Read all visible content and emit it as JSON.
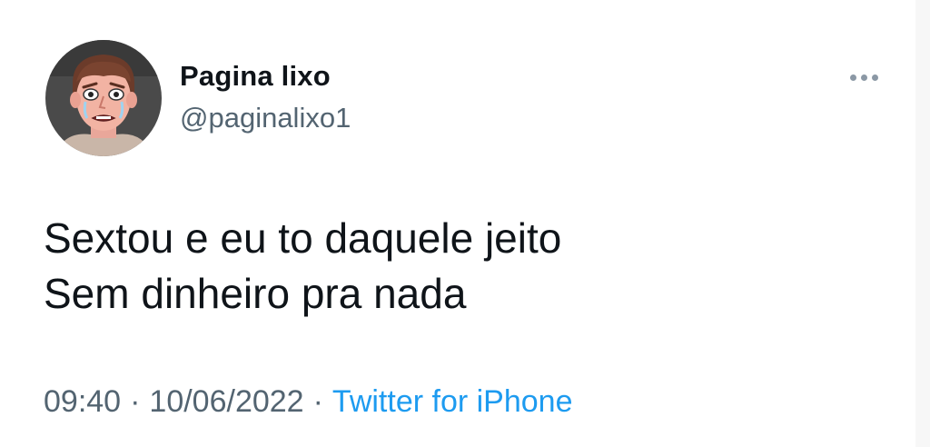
{
  "user": {
    "display_name": "Pagina lixo",
    "handle": "@paginalixo1",
    "avatar_icon": "cartoon-face-avatar"
  },
  "more_icon": "ellipsis-icon",
  "tweet": {
    "lines": [
      "Sextou e eu to daquele jeito",
      "Sem dinheiro pra nada"
    ]
  },
  "meta": {
    "time": "09:40",
    "separator": "·",
    "date": "10/06/2022",
    "source": "Twitter for iPhone"
  },
  "colors": {
    "text_primary": "#0f1419",
    "text_secondary": "#536471",
    "link": "#1d9bf0"
  }
}
